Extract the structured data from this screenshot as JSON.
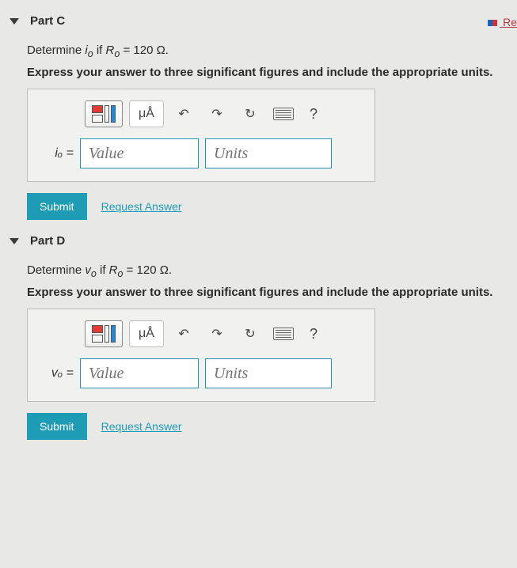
{
  "topRight": {
    "label": "Re"
  },
  "common": {
    "submitLabel": "Submit",
    "requestLabel": "Request Answer",
    "valuePlaceholder": "Value",
    "unitsPlaceholder": "Units",
    "unitsButton": "μÅ",
    "helpLabel": "?"
  },
  "partC": {
    "title": "Part C",
    "promptPrefix": "Determine ",
    "var": "i",
    "sub": "o",
    "promptMid": " if ",
    "condVar": "R",
    "condSub": "o",
    "condRest": " = 120 Ω.",
    "instruction": "Express your answer to three significant figures and include the appropriate units.",
    "rowLabel": "iₒ ="
  },
  "partD": {
    "title": "Part D",
    "promptPrefix": "Determine ",
    "var": "v",
    "sub": "o",
    "promptMid": " if ",
    "condVar": "R",
    "condSub": "o",
    "condRest": " = 120 Ω.",
    "instruction": "Express your answer to three significant figures and include the appropriate units.",
    "rowLabel": "vₒ ="
  }
}
